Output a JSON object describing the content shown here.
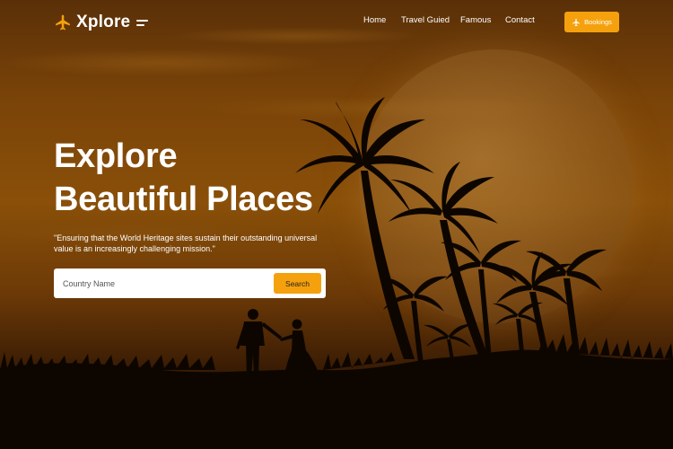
{
  "brand": {
    "name": "Xplore",
    "logo_icon": "airplane-icon",
    "menu_icon": "menu-icon"
  },
  "nav": {
    "links": [
      "Home",
      "Travel Guied",
      "Famous",
      "Contact"
    ],
    "bookings_label": "Bookings",
    "bookings_icon": "airplane-icon"
  },
  "hero": {
    "headline_line1": "Explore",
    "headline_line2": "Beautiful Places",
    "tagline": "\"Ensuring that the World Heritage sites sustain their outstanding universal value is an increasingly challenging mission.\""
  },
  "search": {
    "placeholder": "Country Name",
    "value": "",
    "button_label": "Search"
  },
  "colors": {
    "accent": "#f5a10e",
    "sky": "#7a4308",
    "text": "#ffffff"
  }
}
